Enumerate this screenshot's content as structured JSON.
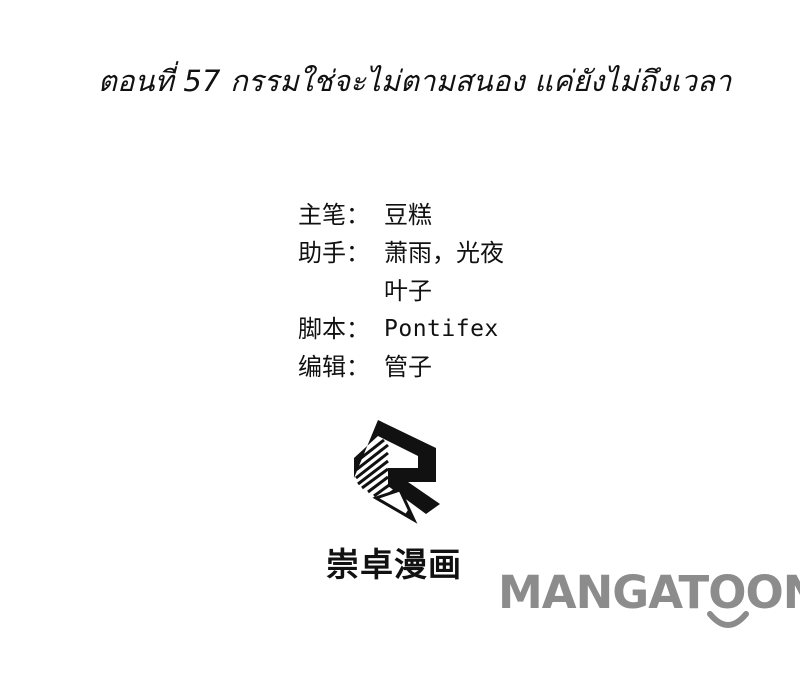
{
  "chapter": {
    "title": "ตอนที่ 57 กรรมใช่จะไม่ตามสนอง แค่ยังไม่ถึงเวลา"
  },
  "credits": [
    {
      "role": "主笔：",
      "value": "豆糕"
    },
    {
      "role": "助手：",
      "value": "萧雨，光夜"
    },
    {
      "role": "",
      "value": "叶子"
    },
    {
      "role": "脚本：",
      "value": "Pontifex"
    },
    {
      "role": "编辑：",
      "value": "管子"
    }
  ],
  "studio": {
    "name": "崇卓漫画",
    "logo_icon": "studio-logo-icon"
  },
  "watermark": {
    "text": "MANGATOON",
    "color": "#8c8c8c"
  }
}
